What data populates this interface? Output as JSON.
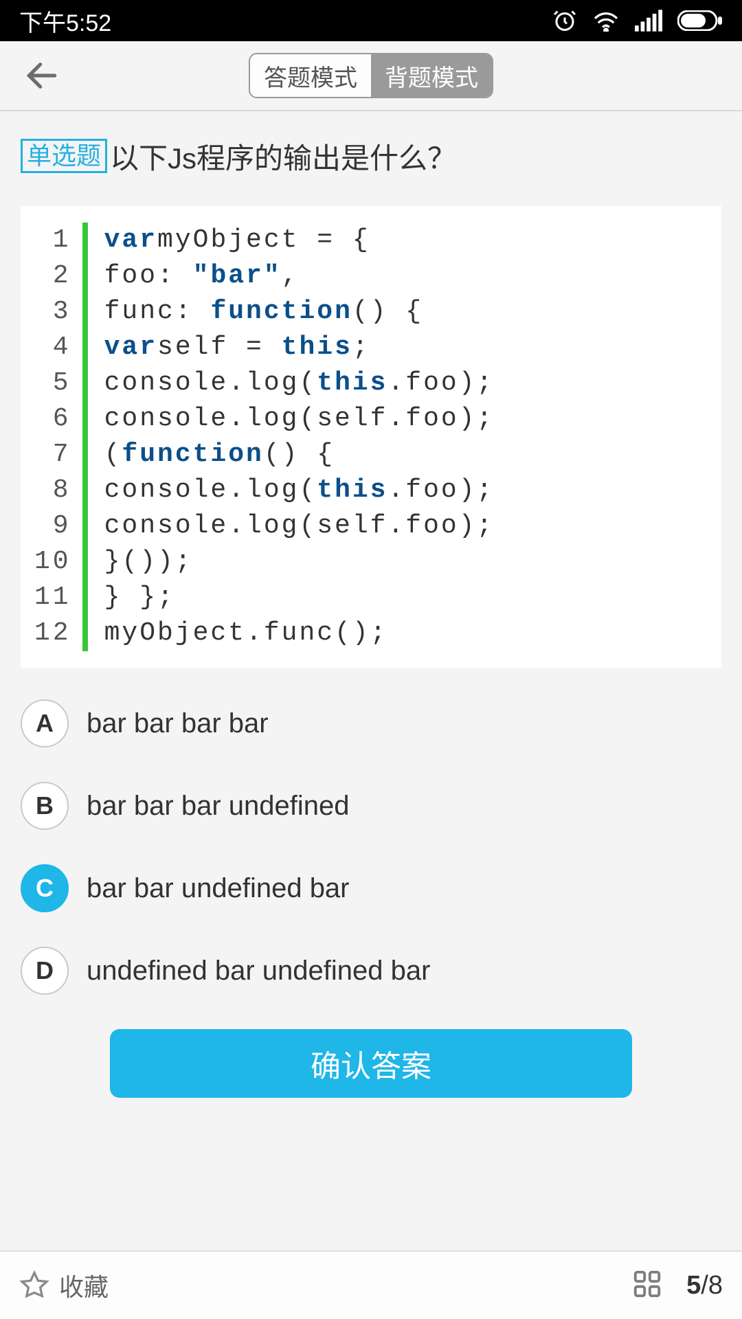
{
  "status": {
    "time": "下午5:52"
  },
  "header": {
    "mode_answer": "答题模式",
    "mode_recite": "背题模式"
  },
  "question": {
    "tag": "单选题",
    "title": "以下Js程序的输出是什么？"
  },
  "code": {
    "line_numbers": [
      "1",
      "2",
      "3",
      "4",
      "5",
      "6",
      "7",
      "8",
      "9",
      "10",
      "11",
      "12"
    ],
    "lines": [
      [
        {
          "t": "var",
          "c": "kw"
        },
        {
          "t": "myObject = {"
        }
      ],
      [
        {
          "t": "foo: "
        },
        {
          "t": "\"bar\"",
          "c": "str"
        },
        {
          "t": ","
        }
      ],
      [
        {
          "t": "func: "
        },
        {
          "t": "function",
          "c": "kw"
        },
        {
          "t": "() {"
        }
      ],
      [
        {
          "t": "var",
          "c": "kw"
        },
        {
          "t": "self = "
        },
        {
          "t": "this",
          "c": "kw"
        },
        {
          "t": ";"
        }
      ],
      [
        {
          "t": "console.log("
        },
        {
          "t": "this",
          "c": "kw"
        },
        {
          "t": ".foo);"
        }
      ],
      [
        {
          "t": "console.log(self.foo);"
        }
      ],
      [
        {
          "t": "("
        },
        {
          "t": "function",
          "c": "kw"
        },
        {
          "t": "() {"
        }
      ],
      [
        {
          "t": "console.log("
        },
        {
          "t": "this",
          "c": "kw"
        },
        {
          "t": ".foo);"
        }
      ],
      [
        {
          "t": "console.log(self.foo);"
        }
      ],
      [
        {
          "t": "}());"
        }
      ],
      [
        {
          "t": "} };"
        }
      ],
      [
        {
          "t": "myObject.func();"
        }
      ]
    ]
  },
  "options": [
    {
      "letter": "A",
      "text": "bar bar bar bar",
      "selected": false
    },
    {
      "letter": "B",
      "text": "bar bar bar undefined",
      "selected": false
    },
    {
      "letter": "C",
      "text": "bar bar undefined bar",
      "selected": true
    },
    {
      "letter": "D",
      "text": "undefined bar undefined bar",
      "selected": false
    }
  ],
  "confirm_label": "确认答案",
  "bottom": {
    "favorite_label": "收藏",
    "current": "5",
    "total": "8"
  }
}
